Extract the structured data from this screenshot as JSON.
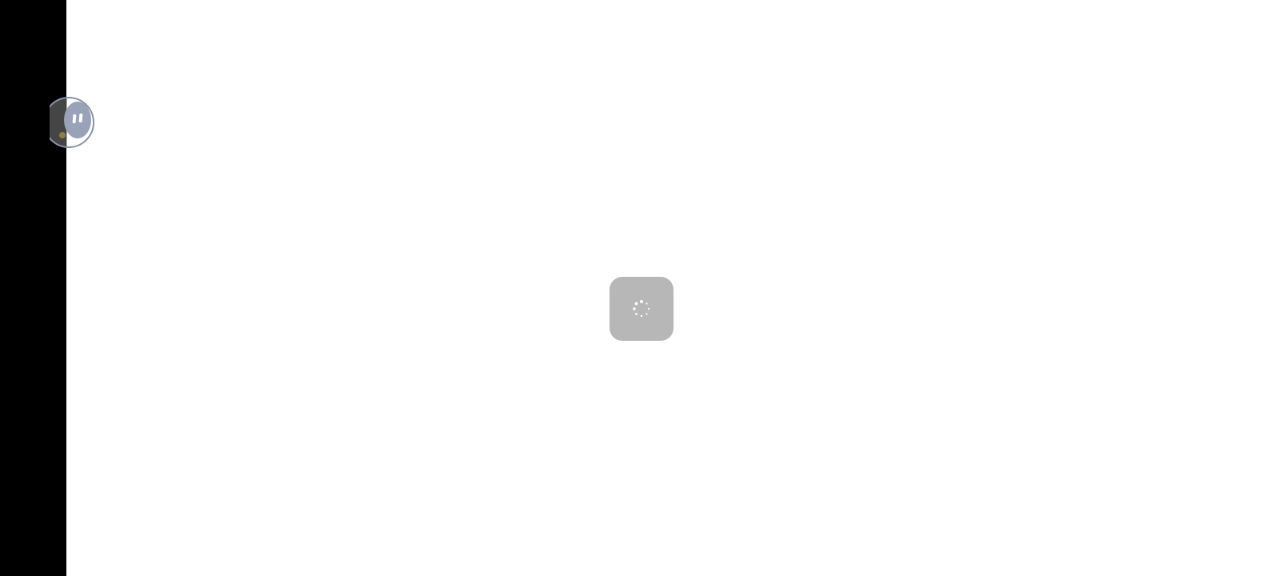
{
  "screen": {
    "background_color": "#ffffff",
    "cutout_color": "#000000"
  },
  "floating_ball": {
    "icon": "pause-icon",
    "ring_color": "#8a93a6",
    "fill_color": "#98a2b8"
  },
  "loading": {
    "icon": "spinner-icon",
    "dialog_color": "#b7b7b7",
    "dot_color": "#ffffff"
  }
}
